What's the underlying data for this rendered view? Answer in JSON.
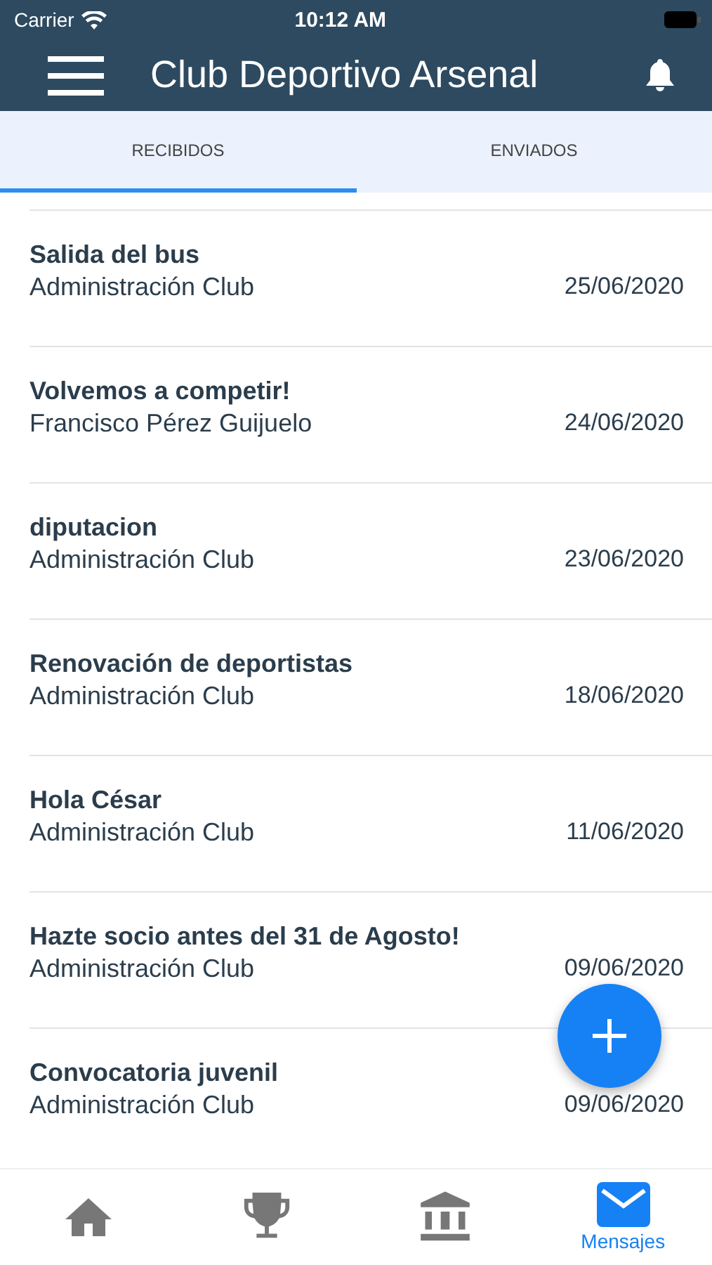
{
  "status_bar": {
    "carrier": "Carrier",
    "time": "10:12 AM"
  },
  "nav_bar": {
    "title": "Club Deportivo Arsenal"
  },
  "tabs": [
    {
      "label": "RECIBIDOS",
      "selected": true
    },
    {
      "label": "ENVIADOS",
      "selected": false
    }
  ],
  "messages": [
    {
      "subject": "Salida del bus",
      "sender": "Administración Club",
      "date": "25/06/2020"
    },
    {
      "subject": "Volvemos a competir!",
      "sender": "Francisco Pérez Guijuelo",
      "date": "24/06/2020"
    },
    {
      "subject": "diputacion",
      "sender": "Administración Club",
      "date": "23/06/2020"
    },
    {
      "subject": "Renovación de deportistas",
      "sender": "Administración Club",
      "date": "18/06/2020"
    },
    {
      "subject": "Hola César",
      "sender": "Administración Club",
      "date": "11/06/2020"
    },
    {
      "subject": "Hazte socio antes del 31 de Agosto!",
      "sender": "Administración Club",
      "date": "09/06/2020"
    },
    {
      "subject": "Convocatoria juvenil",
      "sender": "Administración Club",
      "date": "09/06/2020"
    }
  ],
  "tab_bar": [
    {
      "kind": "home",
      "selected": false
    },
    {
      "kind": "trophy",
      "selected": false
    },
    {
      "kind": "institution",
      "selected": false
    },
    {
      "kind": "mail",
      "label": "Mensajes",
      "selected": true
    }
  ]
}
